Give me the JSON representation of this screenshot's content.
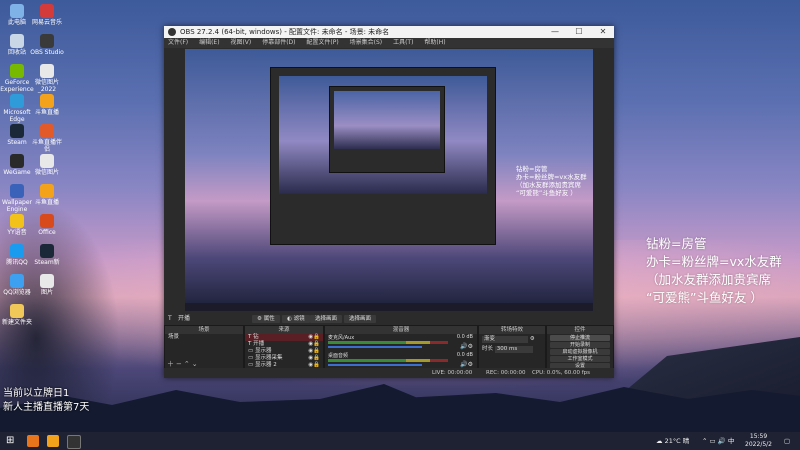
{
  "desktop": {
    "icons": [
      {
        "label": "此电脑",
        "color": "#7fb3e8"
      },
      {
        "label": "网易云音乐",
        "color": "#d33b3b"
      },
      {
        "label": "回收站",
        "color": "#c8d6e6"
      },
      {
        "label": "OBS Studio",
        "color": "#3a3a3a"
      },
      {
        "label": "GeForce Experience",
        "color": "#76b900"
      },
      {
        "label": "微信图片_2022",
        "color": "#e8e8e8"
      },
      {
        "label": "Microsoft Edge",
        "color": "#2f9bd9"
      },
      {
        "label": "斗鱼直播",
        "color": "#f2a31b"
      },
      {
        "label": "Steam",
        "color": "#1b2838"
      },
      {
        "label": "斗鱼直播伴侣",
        "color": "#e35a2a"
      },
      {
        "label": "WeGame",
        "color": "#2a2a2a"
      },
      {
        "label": "微信图片",
        "color": "#e8e8e8"
      },
      {
        "label": "Wallpaper Engine",
        "color": "#3a62b8"
      },
      {
        "label": "斗鱼直播",
        "color": "#f2a31b"
      },
      {
        "label": "YY语音",
        "color": "#f2c21b"
      },
      {
        "label": "Office",
        "color": "#d84a1b"
      },
      {
        "label": "腾讯QQ",
        "color": "#1b9bf0"
      },
      {
        "label": "Steam新",
        "color": "#1b2838"
      },
      {
        "label": "QQ浏览器",
        "color": "#3da0f0"
      },
      {
        "label": "图片",
        "color": "#e8e8e8"
      },
      {
        "label": "新建文件夹",
        "color": "#f0c85a"
      }
    ],
    "stream_text": [
      "当前以立牌日1",
      "新人主播直播第7天"
    ],
    "overlay": {
      "line1": "钻粉=房管",
      "line2": "办卡=粉丝牌=vx水友群",
      "line3": "（加水友群添加贵宾席",
      "line4": "“可爱熊”斗鱼好友 ）"
    }
  },
  "obs": {
    "title": "OBS 27.2.4 (64-bit, windows) - 配置文件: 未命名 - 场景: 未命名",
    "menu": [
      "文件(F)",
      "编辑(E)",
      "视图(V)",
      "停靠部件(D)",
      "配置文件(P)",
      "场景集合(S)",
      "工具(T)",
      "帮助(H)"
    ],
    "scene_label": "开播",
    "scene_toolbar": [
      "属性",
      "滤镜",
      "选择画面",
      "选择画面"
    ],
    "docks": {
      "scenes": {
        "title": "场景",
        "items": [
          "场景"
        ]
      },
      "sources": {
        "title": "来源",
        "items": [
          "钻",
          "开播",
          "显示器",
          "显示器采集",
          "显示器 2"
        ]
      },
      "mixer": {
        "title": "混音器",
        "channels": [
          {
            "name": "麦克风/Aux",
            "db": "0.0 dB",
            "level": 0.78
          },
          {
            "name": "桌面音频",
            "db": "0.0 dB",
            "level": 0.78
          }
        ]
      },
      "transitions": {
        "title": "转场特效",
        "type": "渐变",
        "duration_label": "时长",
        "duration": "300 ms"
      },
      "controls": {
        "title": "控件",
        "buttons": [
          "停止推流",
          "开始录制",
          "启动虚拟摄像机",
          "工作室模式",
          "设置",
          "退出"
        ]
      }
    },
    "status": {
      "live": "LIVE: 00:00:00",
      "rec": "REC: 00:00:00",
      "cpu": "CPU: 0.0%, 60.00 fps"
    }
  },
  "taskbar": {
    "weather": "21°C 晴",
    "ime": "中",
    "time": "15:59",
    "date": "2022/5/2"
  }
}
